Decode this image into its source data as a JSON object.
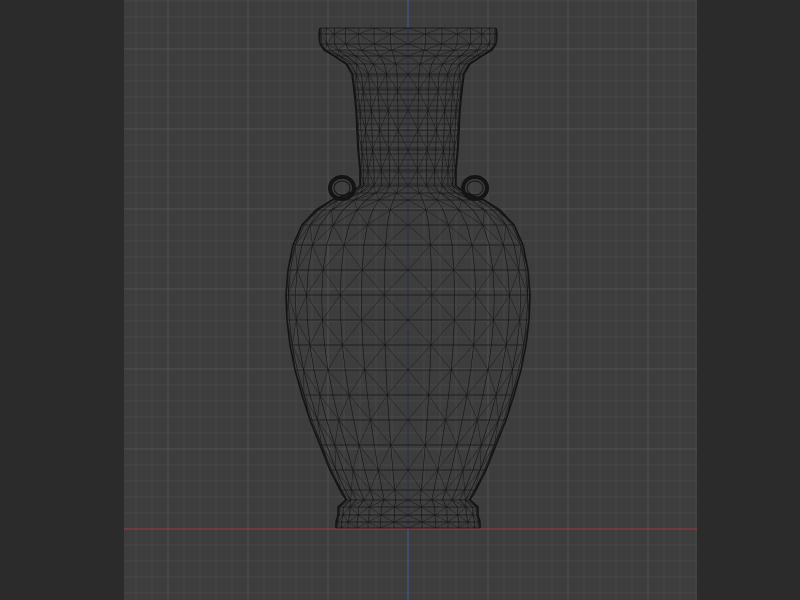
{
  "viewport": {
    "view": "front-orthographic",
    "display_mode": "wireframe",
    "object": "vase-mesh",
    "colors": {
      "background": "#3d3d3d",
      "grid_minor": "#474747",
      "grid_major": "#515151",
      "axis_x": "#a1363f",
      "axis_z": "#3d5f9a",
      "wire": "#141414",
      "side_panel": "#2b2b2b"
    }
  }
}
